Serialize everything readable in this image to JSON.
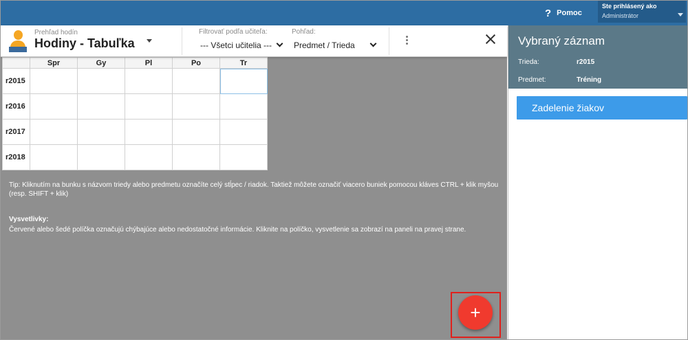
{
  "topbar": {
    "help_icon": "question-icon",
    "help_label": "Pomoc",
    "user_label": "Ste prihlásený ako",
    "user_value": "Administrátor",
    "color": "#2d6da3"
  },
  "toolbar": {
    "crumb": "Prehľad hodín",
    "title": "Hodiny - Tabuľka",
    "filter_label": "Filtrovať podľa učiteľa:",
    "filter_value": "--- Všetci učitelia ---",
    "view_label": "Pohľad:",
    "view_value": "Predmet / Trieda"
  },
  "grid": {
    "columns": [
      "Spr",
      "Gy",
      "Pl",
      "Po",
      "Tr"
    ],
    "rows": [
      "r2015",
      "r2016",
      "r2017",
      "r2018"
    ]
  },
  "tip": "Tip: Kliknutím na bunku s názvom triedy alebo predmetu označíte celý stĺpec / riadok. Taktiež môžete označiť viacero buniek pomocou kláves CTRL + klik myšou (resp. SHIFT + klik)",
  "legend": {
    "heading": "Vysvetlivky:",
    "text": "Červené alebo šedé políčka označujú chýbajúce alebo nedostatočné informácie. Kliknite na políčko, vysvetlenie sa zobrazí na paneli na pravej strane."
  },
  "fab_label": "+",
  "panel": {
    "title": "Vybraný záznam",
    "fields": [
      {
        "key": "Trieda:",
        "value": "r2015"
      },
      {
        "key": "Predmet:",
        "value": "Tréning"
      }
    ],
    "button": "Zadelenie žiakov",
    "header_color": "#5b7988",
    "button_color": "#3d9be9"
  }
}
